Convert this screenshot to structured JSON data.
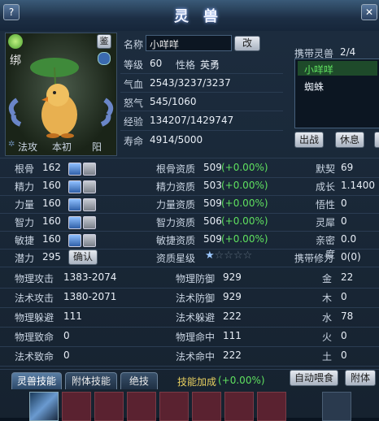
{
  "window": {
    "title": "灵兽",
    "help": "?",
    "close": "✕"
  },
  "portrait": {
    "status": "绑",
    "identify_label": "鉴",
    "tags": [
      "法攻",
      "本初",
      "阳"
    ]
  },
  "info": {
    "name_label": "名称",
    "name_value": "小咩咩",
    "rename_button": "改",
    "level_label": "等级",
    "level_value": "60",
    "personality_label": "性格",
    "personality_value": "英勇",
    "hp_label": "气血",
    "hp_value": "2543/3237/3237",
    "rage_label": "怒气",
    "rage_value": "545/1060",
    "exp_label": "经验",
    "exp_value": "134207/1429747",
    "life_label": "寿命",
    "life_value": "4914/5000"
  },
  "carry": {
    "title": "携带灵兽",
    "count": "2/4",
    "list": [
      "小咩咩",
      "蜘蛛"
    ],
    "buttons": {
      "battle": "出战",
      "rest": "休息"
    }
  },
  "stats": [
    {
      "label": "根骨",
      "value": "162",
      "apt_label": "根骨资质",
      "apt_value": "509",
      "apt_bonus": "(+0.00%)",
      "right_label": "默契",
      "right_value": "69"
    },
    {
      "label": "精力",
      "value": "160",
      "apt_label": "精力资质",
      "apt_value": "503",
      "apt_bonus": "(+0.00%)",
      "right_label": "成长",
      "right_value": "1.1400"
    },
    {
      "label": "力量",
      "value": "160",
      "apt_label": "力量资质",
      "apt_value": "509",
      "apt_bonus": "(+0.00%)",
      "right_label": "悟性",
      "right_value": "0"
    },
    {
      "label": "智力",
      "value": "160",
      "apt_label": "智力资质",
      "apt_value": "506",
      "apt_bonus": "(+0.00%)",
      "right_label": "灵犀",
      "right_value": "0"
    },
    {
      "label": "敏捷",
      "value": "160",
      "apt_label": "敏捷资质",
      "apt_value": "509",
      "apt_bonus": "(+0.00%)",
      "right_label": "亲密度",
      "right_value": "0.0"
    }
  ],
  "potential": {
    "label": "潜力",
    "value": "295",
    "confirm": "确认",
    "grade_label": "资质星级",
    "stars_filled": 1,
    "stars_total": 5,
    "cultivation_label": "携带修为",
    "cultivation_value": "0(0)"
  },
  "combat": [
    {
      "a_label": "物理攻击",
      "a_value": "1383-2074",
      "b_label": "物理防御",
      "b_value": "929",
      "e_label": "金",
      "e_value": "22"
    },
    {
      "a_label": "法术攻击",
      "a_value": "1380-2071",
      "b_label": "法术防御",
      "b_value": "929",
      "e_label": "木",
      "e_value": "0"
    },
    {
      "a_label": "物理躲避",
      "a_value": "111",
      "b_label": "法术躲避",
      "b_value": "222",
      "e_label": "水",
      "e_value": "78"
    },
    {
      "a_label": "物理致命",
      "a_value": "0",
      "b_label": "物理命中",
      "b_value": "111",
      "e_label": "火",
      "e_value": "0"
    },
    {
      "a_label": "法术致命",
      "a_value": "0",
      "b_label": "法术命中",
      "b_value": "222",
      "e_label": "土",
      "e_value": "0"
    }
  ],
  "bottom": {
    "tabs": [
      "灵兽技能",
      "附体技能",
      "绝技"
    ],
    "bonus_label": "技能加成",
    "bonus_value": "(+0.00%)",
    "auto_feed": "自动喂食",
    "possess": "附体"
  },
  "colors": {
    "accent_green": "#5fe05f",
    "slot_empty": "#5a2230"
  }
}
